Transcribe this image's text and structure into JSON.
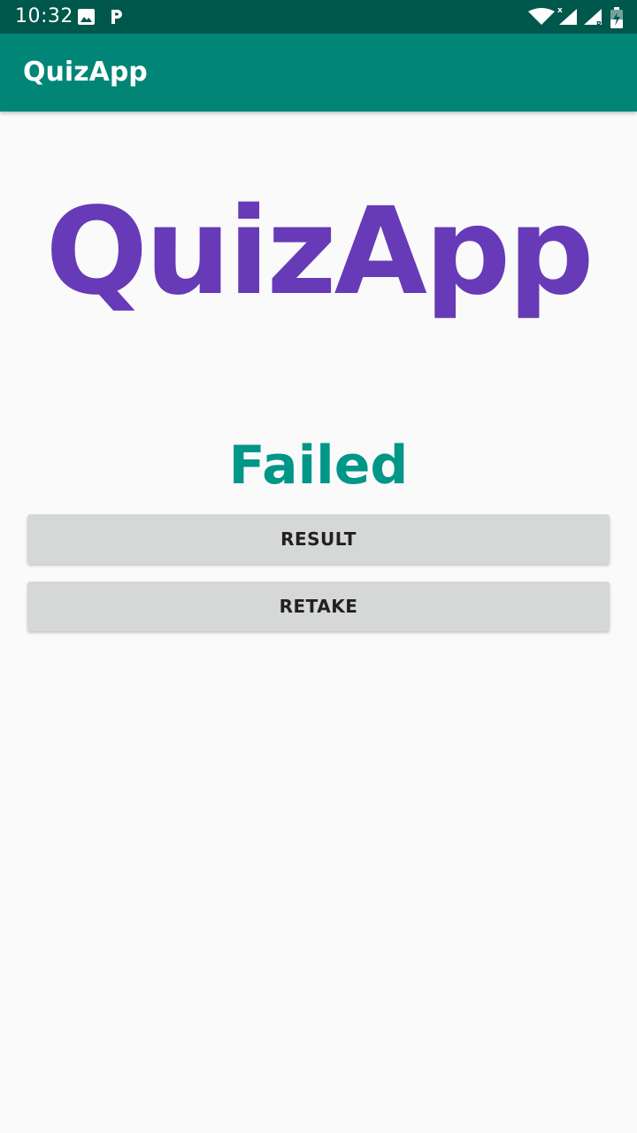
{
  "status_bar": {
    "time": "10:32",
    "icons": [
      "image-icon",
      "parking-icon",
      "wifi-icon",
      "signal-x-icon",
      "signal-r-icon",
      "battery-charging-icon"
    ]
  },
  "app_bar": {
    "title": "QuizApp"
  },
  "main": {
    "logo_text": "QuizApp",
    "result_text": "Failed",
    "result_button_label": "RESULT",
    "retake_button_label": "RETAKE"
  },
  "colors": {
    "status_bar": "#00574b",
    "app_bar": "#008577",
    "logo": "#673ab7",
    "result_text": "#009688",
    "button": "#d6d7d7",
    "background": "#fafafa"
  }
}
